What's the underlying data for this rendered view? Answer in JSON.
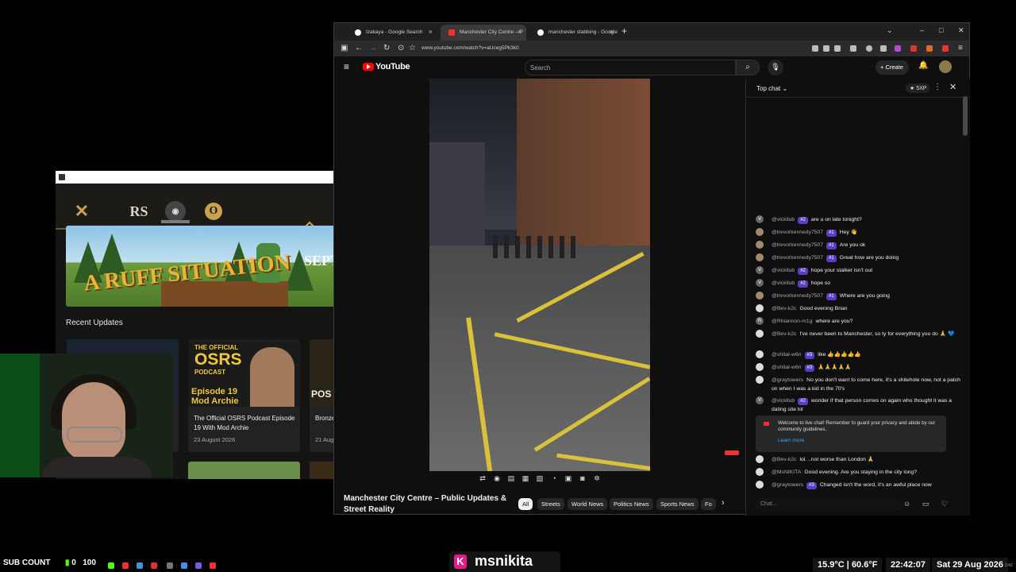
{
  "launcher": {
    "games": [
      "RS",
      "O"
    ],
    "banner_title": "A RUFF SITUATION",
    "banner_sub": "SEPT",
    "recent_title": "Recent Updates",
    "cards": [
      {
        "title": "",
        "date": ""
      },
      {
        "thumb_head": "THE OFFICIAL",
        "thumb_big": "OSRS",
        "thumb_mid": "PODCAST",
        "thumb_ep": "Episode 19",
        "thumb_ep2": "Mod Archie",
        "title": "The Official OSRS Podcast Episode 19 With Mod Archie",
        "date": "23 August 2026"
      },
      {
        "thumb_text": "POS",
        "title": "Bronze",
        "date": "21 Aug"
      }
    ]
  },
  "browser": {
    "tabs": [
      {
        "label": "Izakaya - Google Search"
      },
      {
        "label": "Manchester City Centre – P"
      },
      {
        "label": "manchester stabbing - Google"
      }
    ],
    "url": "www.youtube.com/watch?v=aUceg5Pk3k0"
  },
  "youtube": {
    "brand": "YouTube",
    "search_placeholder": "Search",
    "create_label": "Create",
    "video_title": "Manchester City Centre – Public Updates & Street Reality",
    "chips": [
      "All",
      "Streets",
      "World News",
      "Politics News",
      "Sports News",
      "Fo"
    ]
  },
  "chat": {
    "mode": "Top chat",
    "points": "5XP",
    "messages": [
      {
        "author": "@vickilub",
        "badge": "#2",
        "text": "are u on late tonight?",
        "initial": "V"
      },
      {
        "author": "@trevorkennedy7507",
        "badge": "#1",
        "text": "Hey 👋",
        "initial": ""
      },
      {
        "author": "@trevorkennedy7507",
        "badge": "#1",
        "text": "Are you ok",
        "initial": ""
      },
      {
        "author": "@trevorkennedy7507",
        "badge": "#1",
        "text": "Great how are you doing",
        "initial": ""
      },
      {
        "author": "@vickilub",
        "badge": "#2",
        "text": "hope your stalker isn't out",
        "initial": "V"
      },
      {
        "author": "@vickilub",
        "badge": "#2",
        "text": "hope so",
        "initial": "V"
      },
      {
        "author": "@trevorkennedy7507",
        "badge": "#1",
        "text": "Where are you going",
        "initial": ""
      },
      {
        "author": "@Bev-k2c",
        "badge": "",
        "text": "Good evening Brian",
        "initial": ""
      },
      {
        "author": "@Rhiannon-m1g",
        "badge": "",
        "text": "where are you?",
        "initial": "R"
      },
      {
        "author": "@Bev-k2c",
        "badge": "",
        "text": "I've never been to Manchester, so ty for everything you do 🙏 💙",
        "initial": ""
      },
      {
        "author": "@shital-w6n",
        "badge": "#3",
        "text": "like 👍👍👍👍👍",
        "initial": ""
      },
      {
        "author": "@shital-w6n",
        "badge": "#3",
        "text": "🙏🙏🙏🙏🙏",
        "initial": ""
      },
      {
        "author": "@graytowers",
        "badge": "",
        "text": "No you don't want to come here, it's a shitehole now, not a patch on when I was a kid in the 70's",
        "initial": ""
      },
      {
        "author": "@vickilub",
        "badge": "#2",
        "text": "wonder if that person comes on again who thought it was a dating site lol",
        "initial": "V"
      },
      {
        "author": "@Bev-k2c",
        "badge": "",
        "text": "lol. ..not worse than London 🙏",
        "initial": ""
      },
      {
        "author": "@MsNIKITA",
        "badge": "",
        "text": "Good evening. Are you staying in the city long?",
        "initial": ""
      },
      {
        "author": "@graytowers",
        "badge": "#3",
        "text": "Changed isn't the word, it's an awful place now",
        "initial": ""
      }
    ],
    "welcome_text": "Welcome to live chat! Remember to guard your privacy and abide by our community guidelines.",
    "learn_more": "Learn more",
    "input_placeholder": "Chat..."
  },
  "overlay": {
    "sub_label": "SUB COUNT",
    "sub_value": "0",
    "sub_total": "100",
    "streamer": "msnikita",
    "weather": "15.9°C | 60.6°F",
    "clock": "22:42:07",
    "date": "Sat 29 Aug 2026",
    "tray_time": "2:42"
  },
  "colors": {
    "accent_red": "#ff0000",
    "chat_link": "#3ea6ff",
    "kick_green": "#53fc18"
  }
}
